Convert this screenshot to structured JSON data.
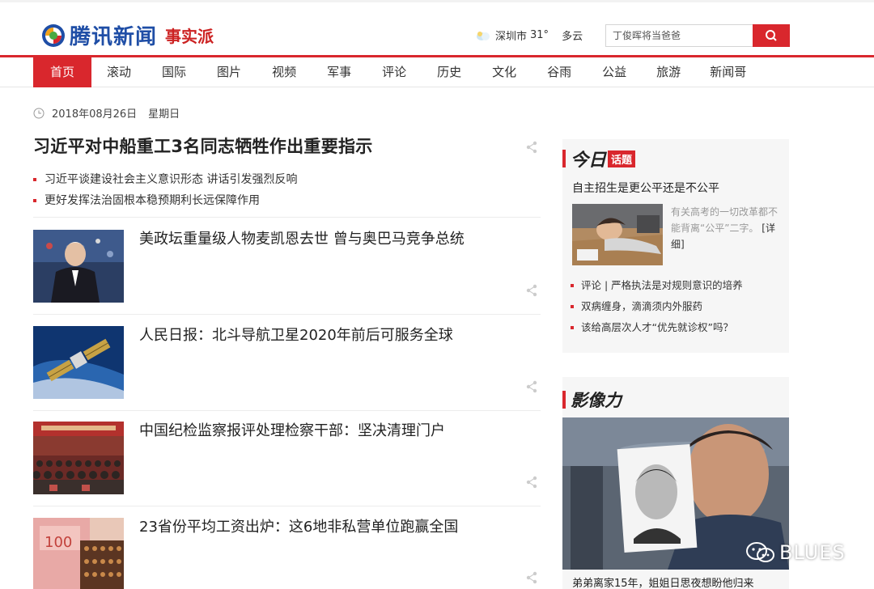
{
  "header": {
    "logo_text": "腾讯新闻",
    "logo_sub": "事实派",
    "weather": {
      "city": "深圳市",
      "temp": "31°",
      "desc": "多云"
    },
    "search": {
      "placeholder": "丁俊晖将当爸爸"
    }
  },
  "nav": {
    "items": [
      "首页",
      "滚动",
      "国际",
      "图片",
      "视频",
      "军事",
      "评论",
      "历史",
      "文化",
      "谷雨",
      "公益",
      "旅游",
      "新闻哥"
    ],
    "active_index": 0
  },
  "date": {
    "date": "2018年08月26日",
    "weekday": "星期日"
  },
  "headline": {
    "title": "习近平对中船重工3名同志牺牲作出重要指示",
    "links": [
      "习近平谈建设社会主义意识形态 讲话引发强烈反响",
      "更好发挥法治固根本稳预期利长远保障作用"
    ]
  },
  "news": [
    {
      "title": "美政坛重量级人物麦凯恩去世 曾与奥巴马竞争总统"
    },
    {
      "title": "人民日报：北斗导航卫星2020年前后可服务全球"
    },
    {
      "title": "中国纪检监察报评处理检察干部：坚决清理门户"
    },
    {
      "title": "23省份平均工资出炉：这6地非私营单位跑赢全国"
    }
  ],
  "today": {
    "heading_a": "今日",
    "heading_b": "话题",
    "question": "自主招生是更公平还是不公平",
    "desc": "有关高考的一切改革都不能背离“公平”二字。",
    "more": "[详细]",
    "links": [
      "评论 | 严格执法是对规则意识的培养",
      "双病缠身，滴滴须内外服药",
      "该给高层次人才“优先就诊权”吗？"
    ]
  },
  "impact": {
    "heading": "影像力",
    "caption": "弟弟离家15年，姐姐日思夜想盼他归来"
  },
  "watermark": "BLUES",
  "colors": {
    "accent": "#d9272d",
    "brand_blue": "#1f4ea6"
  }
}
